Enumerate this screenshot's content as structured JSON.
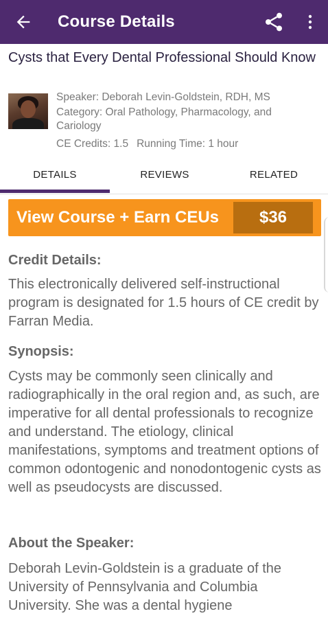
{
  "appbar": {
    "title": "Course Details",
    "back_icon": "arrow-left-icon",
    "share_icon": "share-icon",
    "more_icon": "more-vert-icon",
    "color": "#4e2a6e"
  },
  "course": {
    "title": "Cysts that Every Dental Professional Should Know",
    "speaker": "Speaker: Deborah Levin-Goldstein, RDH, MS",
    "category": "Category: Oral Pathology, Pharmacology, and Cariology",
    "ce_credits": "CE Credits: 1.5",
    "running_time": "Running Time: 1 hour"
  },
  "tabs": [
    {
      "label": "DETAILS",
      "selected": true
    },
    {
      "label": "REVIEWS",
      "selected": false
    },
    {
      "label": "RELATED",
      "selected": false
    }
  ],
  "cta": {
    "label": "View Course + Earn CEUs",
    "price": "$36",
    "color": "#f7941d"
  },
  "sections": {
    "credit_heading": "Credit Details:",
    "credit_text": "This electronically delivered self-instructional program is designated for 1.5 hours of CE credit by Farran Media.",
    "synopsis_heading": "Synopsis:",
    "synopsis_text": "Cysts may be commonly seen clinically and radiographically in the oral region and, as such, are imperative for all dental professionals to recognize and understand. The etiology, clinical manifestations, symptoms and treatment options of common odontogenic and nonodontogenic cysts as well as pseudocysts are discussed.",
    "about_heading": "About the Speaker:",
    "about_text": "Deborah Levin-Goldstein is a graduate of the University of Pennsylvania and Columbia University. She was a dental hygiene"
  }
}
